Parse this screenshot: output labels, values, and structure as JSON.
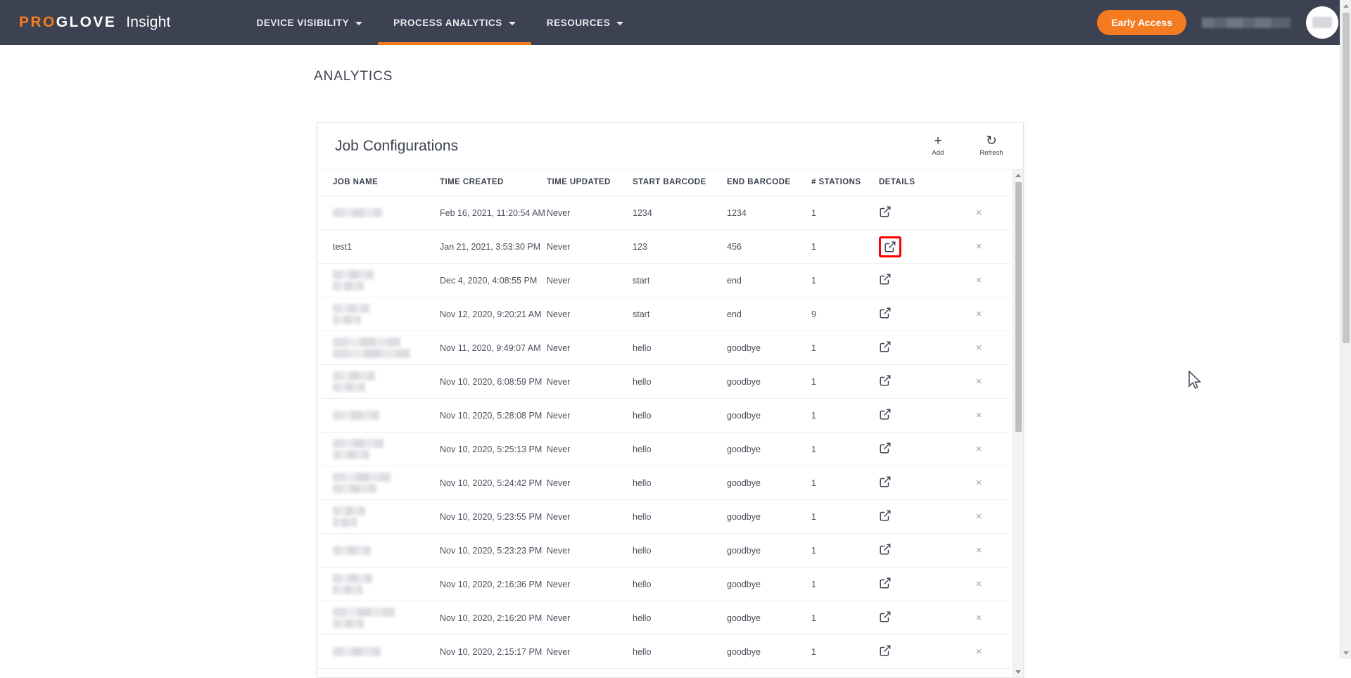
{
  "nav": {
    "brand": {
      "pro": "PRO",
      "glove": "GLOVE",
      "product": "Insight"
    },
    "items": [
      {
        "label": "DEVICE VISIBILITY",
        "icon": "chevron-down-icon",
        "active": false
      },
      {
        "label": "PROCESS ANALYTICS",
        "icon": "chevron-down-icon",
        "active": true
      },
      {
        "label": "RESOURCES",
        "icon": "chevron-down-icon",
        "active": false
      }
    ],
    "early_access_label": "Early Access",
    "user_name": "",
    "accent_color": "#f47b20",
    "bar_color": "#3c4251"
  },
  "page": {
    "title": "ANALYTICS"
  },
  "card": {
    "title": "Job Configurations",
    "actions": [
      {
        "name": "add-button",
        "glyph": "+",
        "label": "Add"
      },
      {
        "name": "refresh-button",
        "glyph": "↻",
        "label": "Refresh"
      }
    ]
  },
  "table": {
    "columns": [
      "JOB NAME",
      "TIME CREATED",
      "TIME UPDATED",
      "START BARCODE",
      "END BARCODE",
      "# STATIONS",
      "DETAILS",
      ""
    ],
    "rows": [
      {
        "job_name": "",
        "redacted": true,
        "redact_widths": [
          70
        ],
        "time_created": "Feb 16, 2021, 11:20:54 AM",
        "time_updated": "Never",
        "start_barcode": "1234",
        "end_barcode": "1234",
        "stations": "1",
        "highlighted": false
      },
      {
        "job_name": "test1",
        "redacted": false,
        "redact_widths": [],
        "time_created": "Jan 21, 2021, 3:53:30 PM",
        "time_updated": "Never",
        "start_barcode": "123",
        "end_barcode": "456",
        "stations": "1",
        "highlighted": true
      },
      {
        "job_name": "",
        "redacted": true,
        "redact_widths": [
          58,
          44
        ],
        "time_created": "Dec 4, 2020, 4:08:55 PM",
        "time_updated": "Never",
        "start_barcode": "start",
        "end_barcode": "end",
        "stations": "1",
        "highlighted": false
      },
      {
        "job_name": "",
        "redacted": true,
        "redact_widths": [
          52,
          40
        ],
        "time_created": "Nov 12, 2020, 9:20:21 AM",
        "time_updated": "Never",
        "start_barcode": "start",
        "end_barcode": "end",
        "stations": "9",
        "highlighted": false
      },
      {
        "job_name": "",
        "redacted": true,
        "redact_widths": [
          96,
          110
        ],
        "time_created": "Nov 11, 2020, 9:49:07 AM",
        "time_updated": "Never",
        "start_barcode": "hello",
        "end_barcode": "goodbye",
        "stations": "1",
        "highlighted": false
      },
      {
        "job_name": "",
        "redacted": true,
        "redact_widths": [
          60,
          46
        ],
        "time_created": "Nov 10, 2020, 6:08:59 PM",
        "time_updated": "Never",
        "start_barcode": "hello",
        "end_barcode": "goodbye",
        "stations": "1",
        "highlighted": false
      },
      {
        "job_name": "",
        "redacted": true,
        "redact_widths": [
          66
        ],
        "time_created": "Nov 10, 2020, 5:28:08 PM",
        "time_updated": "Never",
        "start_barcode": "hello",
        "end_barcode": "goodbye",
        "stations": "1",
        "highlighted": false
      },
      {
        "job_name": "",
        "redacted": true,
        "redact_widths": [
          72,
          52
        ],
        "time_created": "Nov 10, 2020, 5:25:13 PM",
        "time_updated": "Never",
        "start_barcode": "hello",
        "end_barcode": "goodbye",
        "stations": "1",
        "highlighted": false
      },
      {
        "job_name": "",
        "redacted": true,
        "redact_widths": [
          82,
          62
        ],
        "time_created": "Nov 10, 2020, 5:24:42 PM",
        "time_updated": "Never",
        "start_barcode": "hello",
        "end_barcode": "goodbye",
        "stations": "1",
        "highlighted": false
      },
      {
        "job_name": "",
        "redacted": true,
        "redact_widths": [
          46,
          34
        ],
        "time_created": "Nov 10, 2020, 5:23:55 PM",
        "time_updated": "Never",
        "start_barcode": "hello",
        "end_barcode": "goodbye",
        "stations": "1",
        "highlighted": false
      },
      {
        "job_name": "",
        "redacted": true,
        "redact_widths": [
          54
        ],
        "time_created": "Nov 10, 2020, 5:23:23 PM",
        "time_updated": "Never",
        "start_barcode": "hello",
        "end_barcode": "goodbye",
        "stations": "1",
        "highlighted": false
      },
      {
        "job_name": "",
        "redacted": true,
        "redact_widths": [
          56,
          42
        ],
        "time_created": "Nov 10, 2020, 2:16:36 PM",
        "time_updated": "Never",
        "start_barcode": "hello",
        "end_barcode": "goodbye",
        "stations": "1",
        "highlighted": false
      },
      {
        "job_name": "",
        "redacted": true,
        "redact_widths": [
          88,
          44
        ],
        "time_created": "Nov 10, 2020, 2:16:20 PM",
        "time_updated": "Never",
        "start_barcode": "hello",
        "end_barcode": "goodbye",
        "stations": "1",
        "highlighted": false
      },
      {
        "job_name": "",
        "redacted": true,
        "redact_widths": [
          68
        ],
        "time_created": "Nov 10, 2020, 2:15:17 PM",
        "time_updated": "Never",
        "start_barcode": "hello",
        "end_barcode": "goodbye",
        "stations": "1",
        "highlighted": false
      }
    ],
    "details_icon": "external-link-icon",
    "delete_icon": "close-icon",
    "delete_glyph": "×",
    "highlight_color": "#ff0000"
  }
}
